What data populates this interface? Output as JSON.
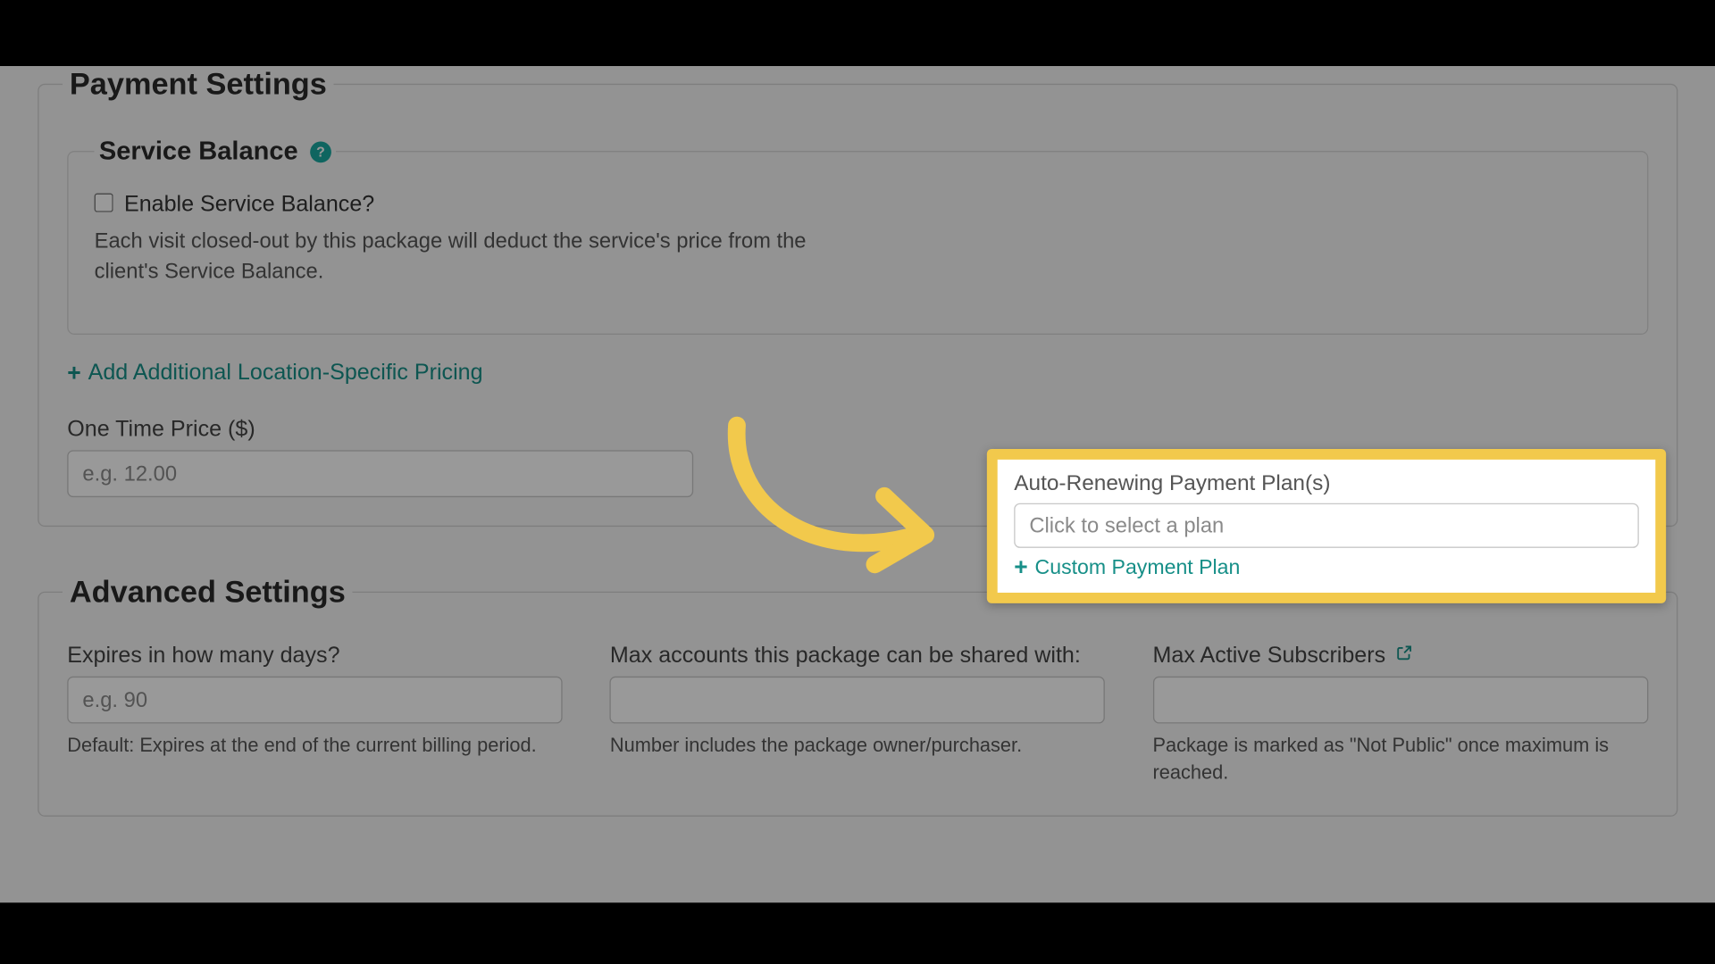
{
  "payment": {
    "title": "Payment Settings",
    "service_balance": {
      "title": "Service Balance",
      "checkbox_label": "Enable Service Balance?",
      "hint": "Each visit closed-out by this package will deduct the service's price from the client's Service Balance."
    },
    "add_location_pricing": "Add Additional Location-Specific Pricing",
    "one_time_price": {
      "label": "One Time Price ($)",
      "placeholder": "e.g. 12.00"
    },
    "auto_renew": {
      "label": "Auto-Renewing Payment Plan(s)",
      "placeholder": "Click to select a plan",
      "custom_link": "Custom Payment Plan"
    }
  },
  "advanced": {
    "title": "Advanced Settings",
    "expires": {
      "label": "Expires in how many days?",
      "placeholder": "e.g. 90",
      "hint": "Default: Expires at the end of the current billing period."
    },
    "max_accounts": {
      "label": "Max accounts this package can be shared with:",
      "hint": "Number includes the package owner/purchaser."
    },
    "max_subscribers": {
      "label": "Max Active Subscribers",
      "hint": "Package is marked as \"Not Public\" once maximum is reached."
    }
  },
  "colors": {
    "accent": "#178f88",
    "highlight": "#f2c94c"
  }
}
